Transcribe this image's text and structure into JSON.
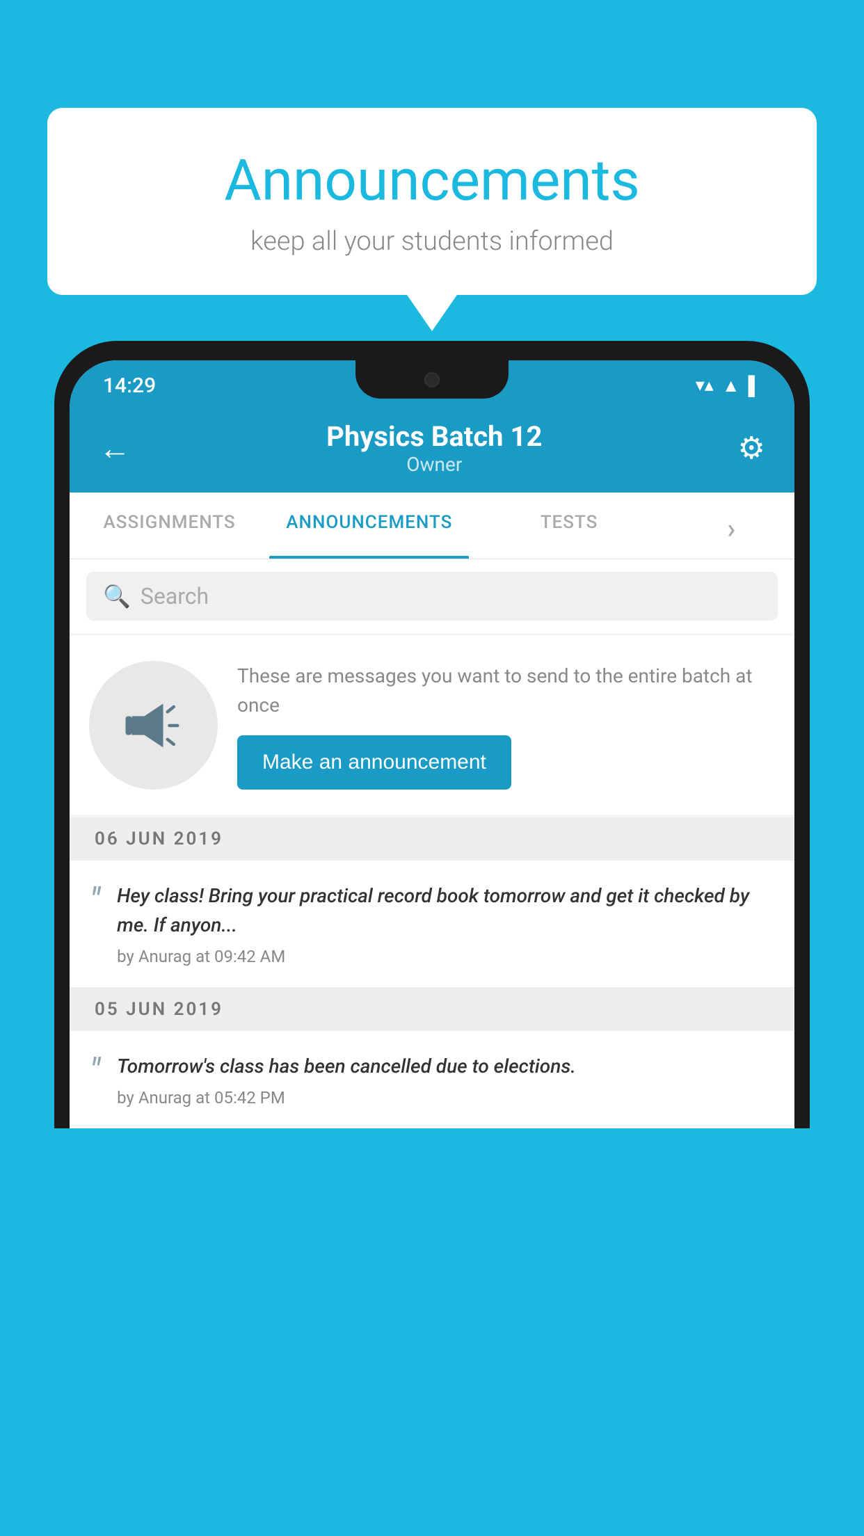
{
  "background_color": "#1bb8e0",
  "bubble": {
    "title": "Announcements",
    "subtitle": "keep all your students informed"
  },
  "status_bar": {
    "time": "14:29",
    "wifi": "▼",
    "signal": "▲",
    "battery": "▌"
  },
  "header": {
    "title": "Physics Batch 12",
    "subtitle": "Owner",
    "back_label": "←",
    "gear_label": "⚙"
  },
  "tabs": [
    {
      "label": "ASSIGNMENTS",
      "active": false
    },
    {
      "label": "ANNOUNCEMENTS",
      "active": true
    },
    {
      "label": "TESTS",
      "active": false
    },
    {
      "label": "›",
      "active": false,
      "partial": true
    }
  ],
  "search": {
    "placeholder": "Search"
  },
  "announcement_prompt": {
    "description": "These are messages you want to send to the entire batch at once",
    "button_label": "Make an announcement"
  },
  "messages": [
    {
      "date": "06  JUN  2019",
      "text": "Hey class! Bring your practical record book tomorrow and get it checked by me. If anyon...",
      "author": "by Anurag at 09:42 AM"
    },
    {
      "date": "05  JUN  2019",
      "text": "Tomorrow's class has been cancelled due to elections.",
      "author": "by Anurag at 05:42 PM"
    }
  ],
  "icons": {
    "megaphone": "📣",
    "quote": "“",
    "back_arrow": "←",
    "gear": "⚙",
    "search": "🔍"
  }
}
